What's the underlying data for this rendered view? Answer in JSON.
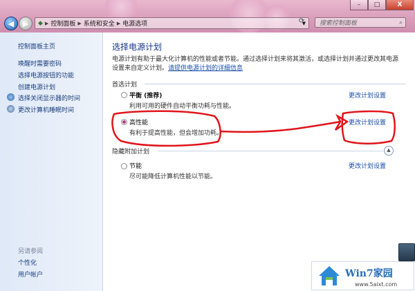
{
  "window": {
    "min_label": "–",
    "max_label": "□",
    "close_label": "X"
  },
  "address": {
    "crumbs": [
      "控制面板",
      "系统和安全",
      "电源选项"
    ]
  },
  "search": {
    "placeholder": "搜索控制面板"
  },
  "sidebar": {
    "home": "控制面板主页",
    "items": [
      "唤醒时需要密码",
      "选择电源按钮的功能",
      "创建电源计划",
      "选择关闭显示器的时间",
      "更改计算机睡眠时间"
    ],
    "see_also_title": "另请参阅",
    "see_also": [
      "个性化",
      "用户帐户"
    ]
  },
  "main": {
    "title": "选择电源计划",
    "description": "电源计划有助于最大化计算机的性能或者节能。通过选择计划来将其激活，或选择计划并通过更改其电源设置来自定义计划。",
    "description_link": "请提供电源计划的详细信息",
    "preferred_title": "首选计划",
    "hidden_title": "隐藏附加计划",
    "plans": [
      {
        "name": "平衡 (推荐)",
        "desc": "利用可用的硬件自动平衡功耗与性能。",
        "selected": false,
        "link": "更改计划设置"
      },
      {
        "name": "高性能",
        "desc": "有利于提高性能，但会增加功耗。",
        "selected": true,
        "link": "更改计划设置"
      },
      {
        "name": "节能",
        "desc": "尽可能降低计算机性能以节能。",
        "selected": false,
        "link": "更改计划设置"
      }
    ]
  },
  "watermark": {
    "brand": "Win7家园",
    "url": "www.5aixt.com"
  },
  "colors": {
    "annotation": "#e0141a",
    "link": "#1a4ca8",
    "title": "#14348a",
    "titlebar": "#d99cba"
  }
}
